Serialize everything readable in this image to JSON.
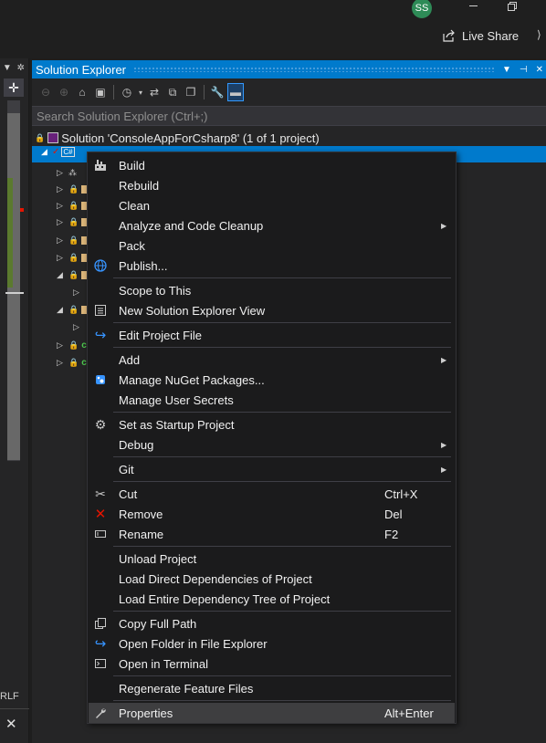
{
  "titlebar": {
    "avatar_initials": "SS",
    "live_share_label": "Live Share"
  },
  "left_strip": {
    "line_ending": "RLF",
    "close_glyph": "✕"
  },
  "solution_explorer": {
    "title": "Solution Explorer",
    "search_placeholder": "Search Solution Explorer (Ctrl+;)",
    "solution_label": "Solution 'ConsoleAppForCsharp8' (1 of 1 project)",
    "project_badge": "C#"
  },
  "context_menu": {
    "items": [
      {
        "label": "Build",
        "icon": "build-icon"
      },
      {
        "label": "Rebuild"
      },
      {
        "label": "Clean"
      },
      {
        "label": "Analyze and Code Cleanup",
        "submenu": true
      },
      {
        "label": "Pack"
      },
      {
        "label": "Publish...",
        "icon": "globe-icon"
      },
      {
        "label": "Scope to This"
      },
      {
        "label": "New Solution Explorer View",
        "icon": "new-view-icon"
      },
      {
        "label": "Edit Project File",
        "icon": "edit-arrow-icon"
      },
      {
        "label": "Add",
        "submenu": true
      },
      {
        "label": "Manage NuGet Packages...",
        "icon": "nuget-icon"
      },
      {
        "label": "Manage User Secrets"
      },
      {
        "label": "Set as Startup Project",
        "icon": "gear-icon"
      },
      {
        "label": "Debug",
        "submenu": true
      },
      {
        "label": "Git",
        "submenu": true
      },
      {
        "label": "Cut",
        "shortcut": "Ctrl+X",
        "icon": "scissors-icon"
      },
      {
        "label": "Remove",
        "shortcut": "Del",
        "icon": "remove-x-icon"
      },
      {
        "label": "Rename",
        "shortcut": "F2",
        "icon": "rename-icon"
      },
      {
        "label": "Unload Project"
      },
      {
        "label": "Load Direct Dependencies of Project"
      },
      {
        "label": "Load Entire Dependency Tree of Project"
      },
      {
        "label": "Copy Full Path",
        "icon": "copy-icon"
      },
      {
        "label": "Open Folder in File Explorer",
        "icon": "open-folder-icon"
      },
      {
        "label": "Open in Terminal",
        "icon": "terminal-icon"
      },
      {
        "label": "Regenerate Feature Files"
      },
      {
        "label": "Properties",
        "shortcut": "Alt+Enter",
        "icon": "wrench-icon"
      }
    ]
  },
  "colors": {
    "accent": "#007acc",
    "menu_bg": "#1b1b1c",
    "hover_bg": "#3e3e40",
    "remove_red": "#e51400"
  }
}
